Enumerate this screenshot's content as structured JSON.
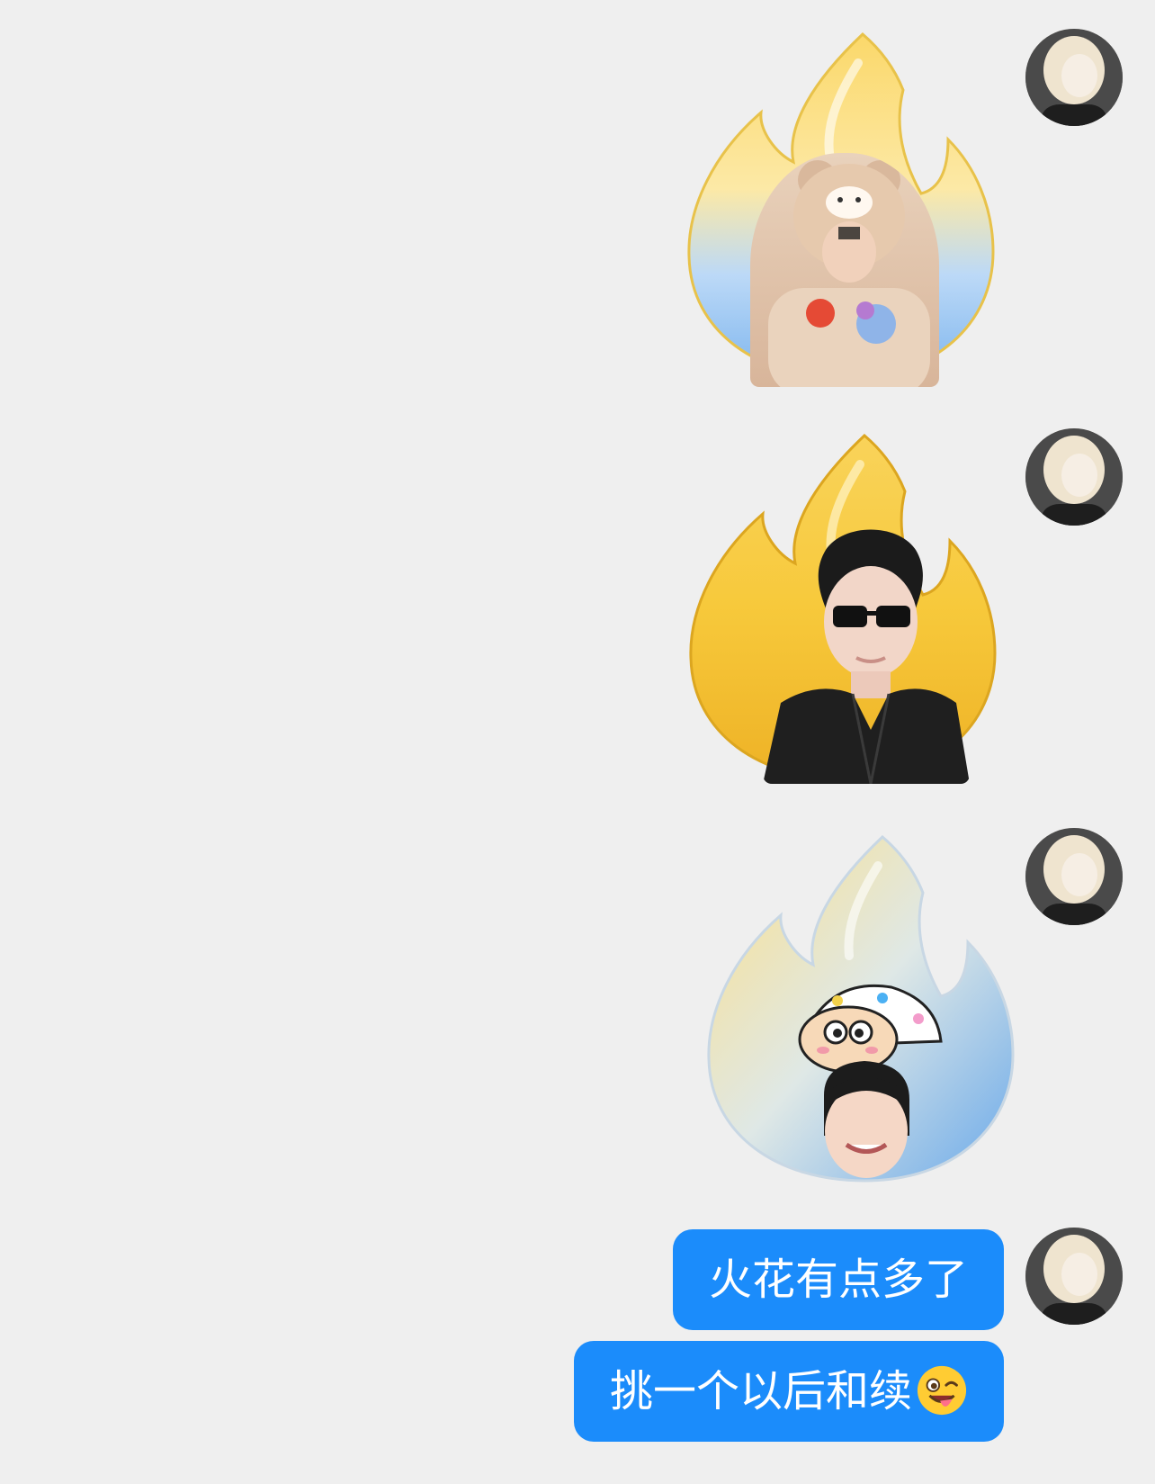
{
  "chat": {
    "background_color": "#efefef",
    "bubble_color": "#1b8cfb",
    "messages": [
      {
        "type": "sticker",
        "sender": "me",
        "flame_style": "yellow-blue",
        "portrait": "bear-costume-person-icon"
      },
      {
        "type": "sticker",
        "sender": "me",
        "flame_style": "yellow",
        "portrait": "sunglasses-person-icon"
      },
      {
        "type": "sticker",
        "sender": "me",
        "flame_style": "yellow-blue",
        "portrait": "cartoon-hat-person-icon"
      },
      {
        "type": "text",
        "sender": "me",
        "text": "火花有点多了"
      },
      {
        "type": "text",
        "sender": "me",
        "text": "挑一个以后和续",
        "emoji": "winking-tongue-emoji"
      }
    ]
  }
}
